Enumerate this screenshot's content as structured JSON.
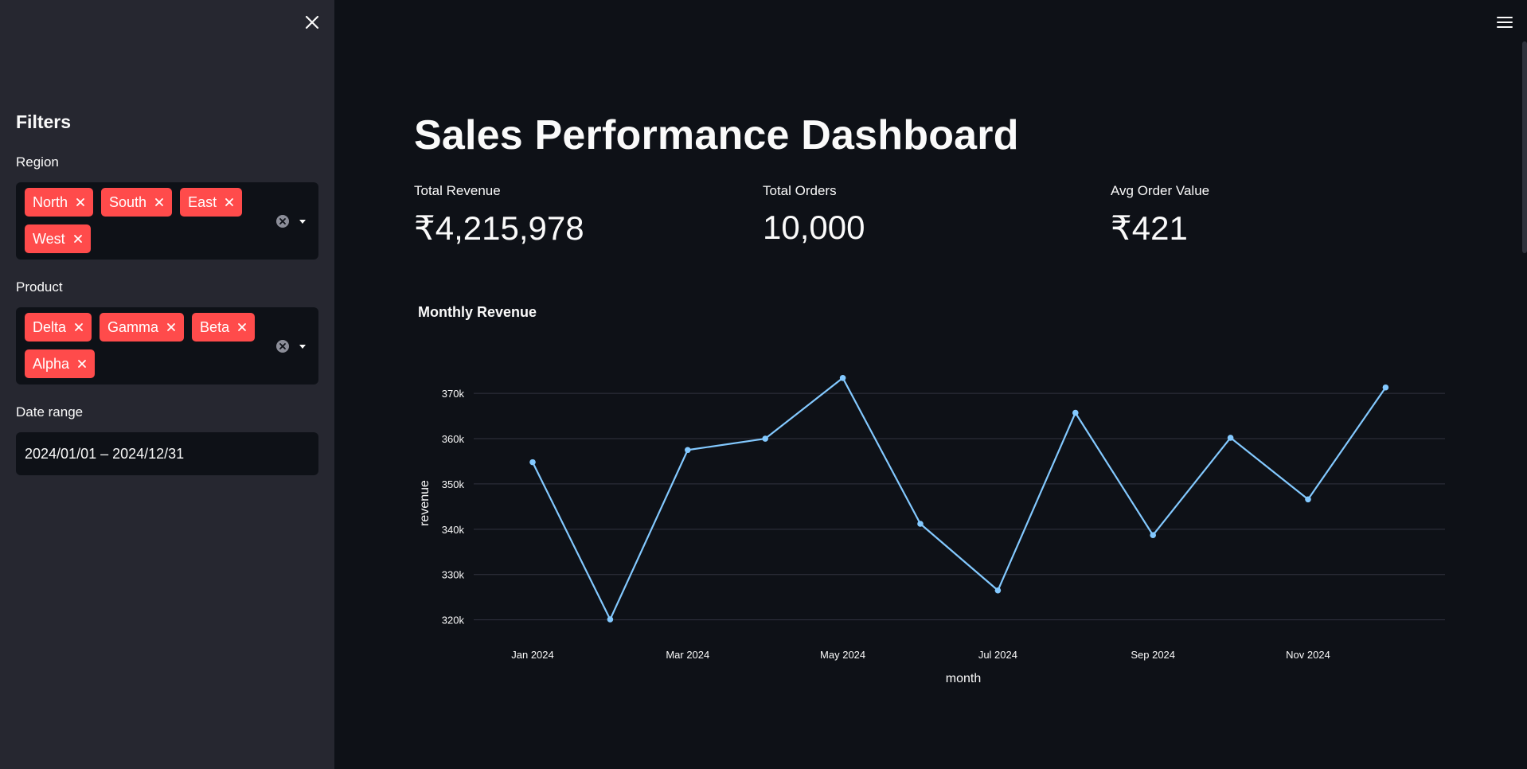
{
  "sidebar": {
    "heading": "Filters",
    "region": {
      "label": "Region",
      "chips": [
        "North",
        "South",
        "East",
        "West"
      ]
    },
    "product": {
      "label": "Product",
      "chips": [
        "Delta",
        "Gamma",
        "Beta",
        "Alpha"
      ]
    },
    "date_range": {
      "label": "Date range",
      "value": "2024/01/01 – 2024/12/31"
    }
  },
  "main": {
    "title": "Sales Performance Dashboard",
    "metrics": [
      {
        "label": "Total Revenue",
        "value": "₹4,215,978"
      },
      {
        "label": "Total Orders",
        "value": "10,000"
      },
      {
        "label": "Avg Order Value",
        "value": "₹421"
      }
    ],
    "chart_title": "Monthly Revenue"
  },
  "icons": {
    "close": "close-icon",
    "menu": "hamburger-menu-icon",
    "chip_remove": "chip-remove-icon",
    "clear": "clear-all-icon",
    "dropdown": "chevron-down-icon"
  },
  "colors": {
    "accent": "#ff4b4b",
    "line": "#83c9ff",
    "background": "#0e1117",
    "sidebar": "#262730"
  },
  "chart_data": {
    "type": "line",
    "x": [
      "2024-01",
      "2024-02",
      "2024-03",
      "2024-04",
      "2024-05",
      "2024-06",
      "2024-07",
      "2024-08",
      "2024-09",
      "2024-10",
      "2024-11",
      "2024-12"
    ],
    "series": [
      {
        "values": [
          354800,
          320100,
          357500,
          360000,
          373400,
          341200,
          326500,
          365700,
          338700,
          360200,
          346600,
          371300
        ]
      }
    ],
    "x_ticks": [
      "Jan 2024",
      "Mar 2024",
      "May 2024",
      "Jul 2024",
      "Sep 2024",
      "Nov 2024"
    ],
    "x_tick_positions": [
      1,
      3,
      5,
      7,
      9,
      11
    ],
    "y_ticks": [
      "320k",
      "330k",
      "340k",
      "350k",
      "360k",
      "370k"
    ],
    "y_tick_values": [
      320000,
      330000,
      340000,
      350000,
      360000,
      370000
    ],
    "ylim": [
      318000,
      376000
    ],
    "xlabel": "month",
    "ylabel": "revenue",
    "grid": true,
    "legend": "none"
  }
}
